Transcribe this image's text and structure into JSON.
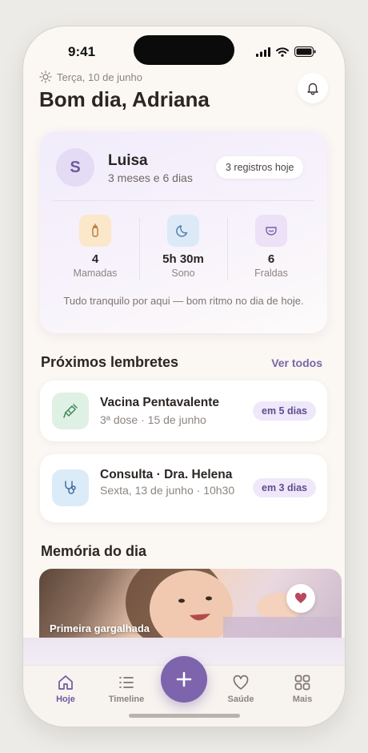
{
  "status_bar": {
    "time": "9:41"
  },
  "header": {
    "date": "Terça, 10 de junho",
    "greeting": "Bom dia, Adriana"
  },
  "baby": {
    "initial": "S",
    "name": "Luisa",
    "age": "3 meses e 6 dias",
    "records_badge": "3 registros hoje",
    "stats": [
      {
        "value": "4",
        "label": "Mamadas",
        "icon": "bottle-icon",
        "color": "#fbe7c9"
      },
      {
        "value": "5h 30m",
        "label": "Sono",
        "icon": "moon-icon",
        "color": "#dceaf8"
      },
      {
        "value": "6",
        "label": "Fraldas",
        "icon": "diaper-icon",
        "color": "#ece1f6"
      }
    ],
    "note": "Tudo tranquilo por aqui — bom ritmo no dia de hoje."
  },
  "reminders": {
    "title": "Próximos lembretes",
    "see_all": "Ver todos",
    "items": [
      {
        "title": "Vacina Pentavalente",
        "subtitle": "3ª dose · 15 de junho",
        "badge": "em 5 dias",
        "icon": "syringe-icon",
        "color": "#dff0e4"
      },
      {
        "title": "Consulta · Dra. Helena",
        "subtitle": "Sexta, 13 de junho · 10h30",
        "badge": "em 3 dias",
        "icon": "stethoscope-icon",
        "color": "#dcebf8"
      }
    ]
  },
  "memory": {
    "title": "Memória do dia",
    "caption": "Primeira gargalhada"
  },
  "tabbar": {
    "items": [
      {
        "label": "Hoje",
        "icon": "home-icon",
        "active": true
      },
      {
        "label": "Timeline",
        "icon": "list-icon",
        "active": false
      },
      {
        "label": "Saúde",
        "icon": "heart-icon",
        "active": false
      },
      {
        "label": "Mais",
        "icon": "grid-icon",
        "active": false
      }
    ],
    "fab_icon": "plus-icon"
  },
  "colors": {
    "accent": "#7d64ac",
    "background": "#fbf7f3"
  }
}
